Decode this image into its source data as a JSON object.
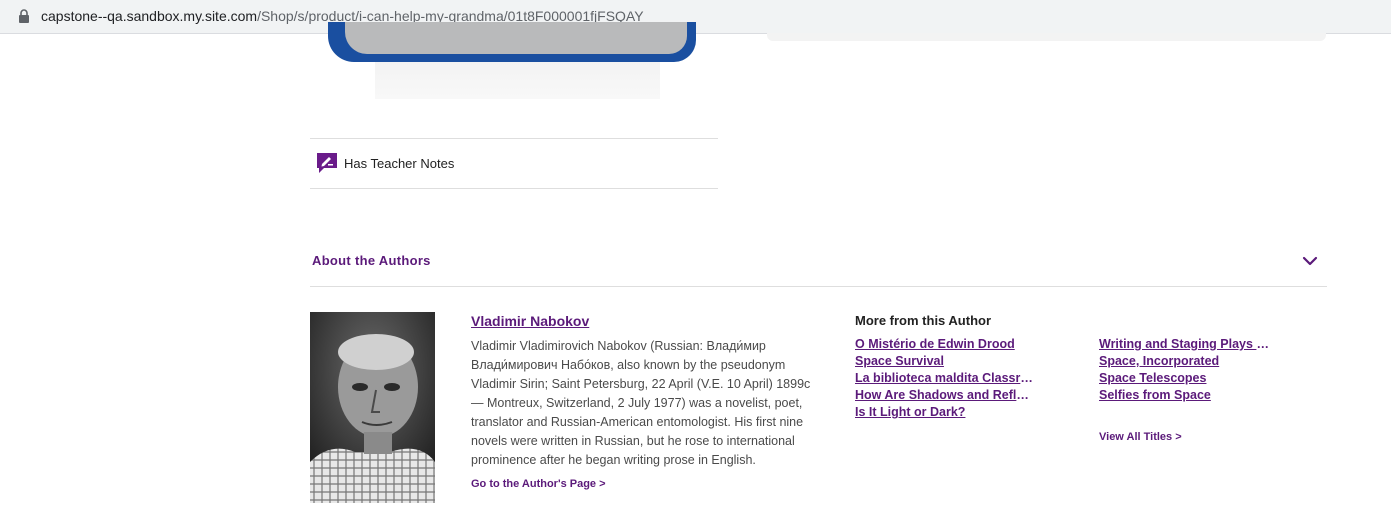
{
  "browser": {
    "url_host": "capstone--qa.sandbox.my.site.com",
    "url_path": "/Shop/s/product/i-can-help-my-grandma/01t8F000001fjFSQAY"
  },
  "product": {
    "teacher_notes_label": "Has Teacher Notes",
    "teacher_notes_icon": "pencil-note-icon"
  },
  "about_authors": {
    "heading": "About the Authors",
    "expanded_icon": "chevron-down-icon",
    "author": {
      "name": "Vladimir Nabokov",
      "bio": "Vladimir Vladimirovich Nabokov (Russian: Влади́мир Влади́мирович Набо́ков, also known by the pseudonym Vladimir Sirin; Saint Petersburg, 22 April (V.E. 10 April) 1899c — Montreux, Switzerland, 2 July 1977) was a novelist, poet, translator and Russian-American entomologist. His first nine novels were written in Russian, but he rose to international prominence after he began writing prose in English.",
      "author_page_link": "Go to the Author's Page >"
    },
    "more_from_author": {
      "heading": "More from this Author",
      "titles_col1": [
        "O Mistério de Edwin Drood",
        "Space Survival",
        "La biblioteca maldita Classroom",
        "How Are Shadows and Reflections",
        "Is It Light or Dark?"
      ],
      "titles_col2": [
        "Writing and Staging Plays Parts",
        "Space, Incorporated",
        "Space Telescopes",
        "Selfies from Space"
      ],
      "view_all": "View All Titles >"
    }
  },
  "colors": {
    "accent_purple": "#5b1a7a",
    "divider": "#dedede"
  }
}
